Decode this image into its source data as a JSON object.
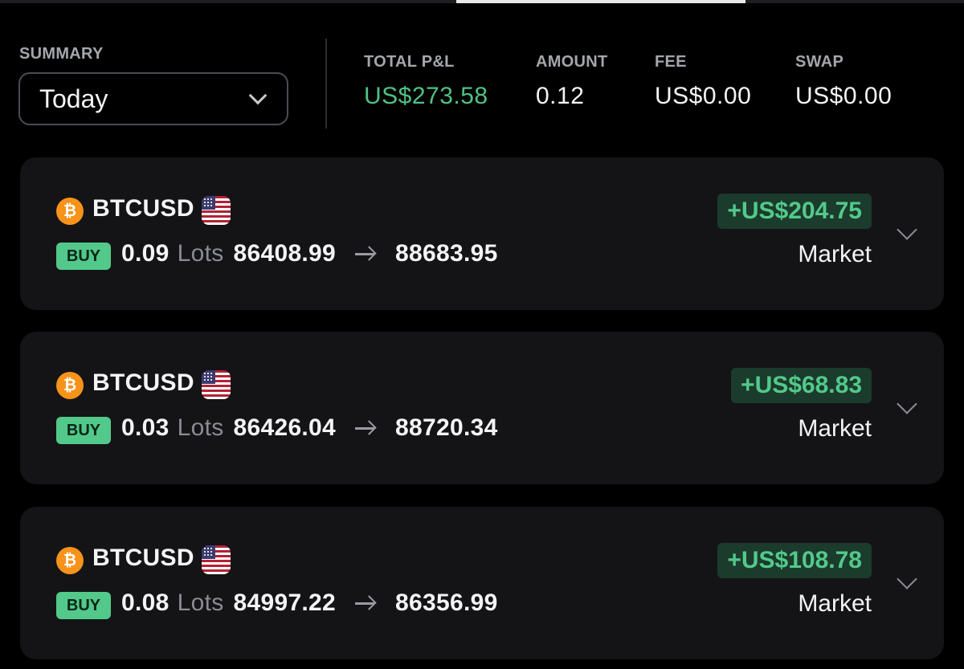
{
  "summary": {
    "label": "SUMMARY",
    "period": "Today",
    "stats": [
      {
        "label": "TOTAL P&L",
        "value": "US$273.58",
        "positive": true
      },
      {
        "label": "AMOUNT",
        "value": "0.12",
        "positive": false
      },
      {
        "label": "FEE",
        "value": "US$0.00",
        "positive": false
      },
      {
        "label": "SWAP",
        "value": "US$0.00",
        "positive": false
      }
    ]
  },
  "trades": [
    {
      "coin_icon": "₿",
      "symbol": "BTCUSD",
      "side": "BUY",
      "qty": "0.09",
      "unit": "Lots",
      "open_price": "86408.99",
      "close_price": "88683.95",
      "pnl": "+US$204.75",
      "order_type": "Market"
    },
    {
      "coin_icon": "₿",
      "symbol": "BTCUSD",
      "side": "BUY",
      "qty": "0.03",
      "unit": "Lots",
      "open_price": "86426.04",
      "close_price": "88720.34",
      "pnl": "+US$68.83",
      "order_type": "Market"
    },
    {
      "coin_icon": "₿",
      "symbol": "BTCUSD",
      "side": "BUY",
      "qty": "0.08",
      "unit": "Lots",
      "open_price": "84997.22",
      "close_price": "86356.99",
      "pnl": "+US$108.78",
      "order_type": "Market"
    }
  ],
  "colors": {
    "positive": "#4fc184",
    "buy_badge": "#52c98a",
    "pnl_badge_bg": "#1b3b2c",
    "card_bg": "#141417",
    "bitcoin": "#f7931a"
  },
  "icons": {
    "coin": "bitcoin-icon",
    "flag": "us-flag-icon",
    "arrow": "arrow-right-icon",
    "expand": "chevron-down-icon"
  }
}
